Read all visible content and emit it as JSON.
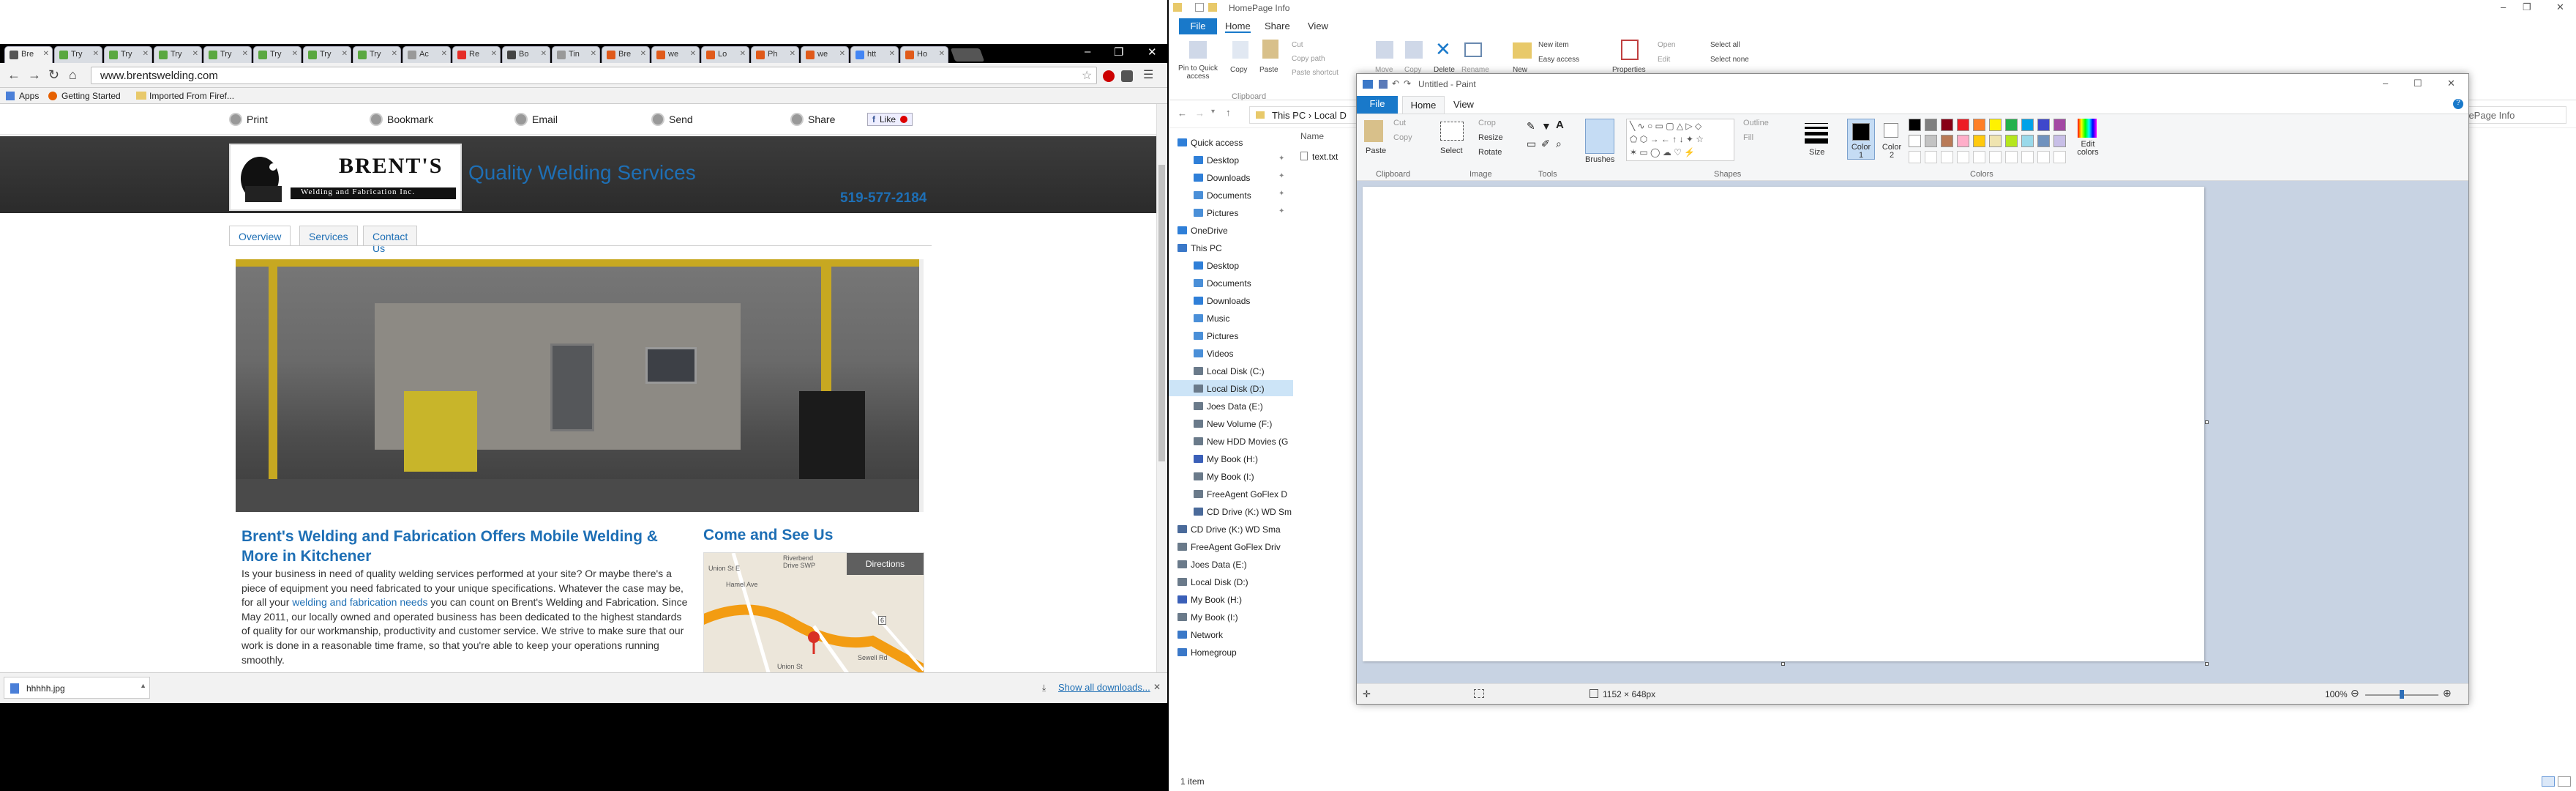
{
  "chrome": {
    "tabs": [
      {
        "label": "Bre",
        "favicon_color": "#555555",
        "active": true
      },
      {
        "label": "Try",
        "favicon_color": "#5aa840"
      },
      {
        "label": "Try",
        "favicon_color": "#5aa840"
      },
      {
        "label": "Try",
        "favicon_color": "#5aa840"
      },
      {
        "label": "Try",
        "favicon_color": "#5aa840"
      },
      {
        "label": "Try",
        "favicon_color": "#5aa840"
      },
      {
        "label": "Try",
        "favicon_color": "#5aa840"
      },
      {
        "label": "Try",
        "favicon_color": "#5aa840"
      },
      {
        "label": "Ac",
        "favicon_color": "#999999"
      },
      {
        "label": "Re",
        "favicon_color": "#e52d27"
      },
      {
        "label": "Bo",
        "favicon_color": "#444444"
      },
      {
        "label": "Tin",
        "favicon_color": "#999999"
      },
      {
        "label": "Bre",
        "favicon_color": "#e05a1a"
      },
      {
        "label": "we",
        "favicon_color": "#e05a1a"
      },
      {
        "label": "Lo",
        "favicon_color": "#e05a1a"
      },
      {
        "label": "Ph",
        "favicon_color": "#e05a1a"
      },
      {
        "label": "we",
        "favicon_color": "#e05a1a"
      },
      {
        "label": "htt",
        "favicon_color": "#4285f4"
      },
      {
        "label": "Ho",
        "favicon_color": "#e05a1a"
      }
    ],
    "url": "www.brentswelding.com",
    "bookmarks": {
      "apps": "Apps",
      "getting_started": "Getting Started",
      "imported": "Imported From Firef..."
    },
    "share_bar": {
      "print": "Print",
      "bookmark": "Bookmark",
      "email": "Email",
      "send": "Send",
      "share": "Share",
      "like": "Like"
    },
    "site": {
      "logo_name": "BRENT'S",
      "logo_sub": "Welding and Fabrication Inc.",
      "tagline": "Quality Welding Services",
      "phone": "519-577-2184",
      "tabs": [
        "Overview",
        "Services",
        "Contact Us"
      ],
      "headline": "Brent's Welding and Fabrication Offers Mobile Welding & More in Kitchener",
      "body_1": "Is your business in need of quality welding services performed at your site? Or maybe there's a piece of equipment you need fabricated to your unique specifications. Whatever the case may be, for all your ",
      "body_link": "welding and fabrication needs",
      "body_2": " you can count on Brent's Welding and Fabrication. Since May 2011, our locally owned and operated business has been dedicated to the highest standards of quality for our workmanship, productivity and customer service. We strive to make sure that our work is done in a reasonable time frame, so that you're able to keep your operations running smoothly.",
      "come_see": "Come and See Us",
      "directions": "Directions",
      "map_labels": [
        "Union St E",
        "Hamel Ave",
        "Riverbend Drive SWP",
        "Union St",
        "Sewell Rd",
        "6"
      ]
    },
    "download": {
      "file": "hhhhh.jpg",
      "show_all": "Show all downloads..."
    }
  },
  "explorer": {
    "title": "HomePage Info",
    "ribbon_tabs": [
      "File",
      "Home",
      "Share",
      "View"
    ],
    "ribbon": {
      "pin": "Pin to Quick access",
      "copy": "Copy",
      "paste": "Paste",
      "cut": "Cut",
      "copy_path": "Copy path",
      "paste_shortcut": "Paste shortcut",
      "clipboard": "Clipboard",
      "move_to": "Move",
      "copy_to": "Copy",
      "delete": "Delete",
      "rename": "Rename",
      "new_folder": "New",
      "new_item": "New item",
      "easy_access": "Easy access",
      "properties": "Properties",
      "open": "Open",
      "edit": "Edit",
      "select_all": "Select all",
      "select_none": "Select none"
    },
    "path": [
      "This PC",
      "Local D"
    ],
    "search": "HomePage Info",
    "column_name": "Name",
    "file": "text.txt",
    "tree": [
      {
        "label": "Quick access",
        "color": "#2f7fd8",
        "indent": 0
      },
      {
        "label": "Desktop",
        "color": "#2f7fd8",
        "indent": 1,
        "pin": true
      },
      {
        "label": "Downloads",
        "color": "#2f7fd8",
        "indent": 1,
        "pin": true
      },
      {
        "label": "Documents",
        "color": "#4a8fd8",
        "indent": 1,
        "pin": true
      },
      {
        "label": "Pictures",
        "color": "#4a8fd8",
        "indent": 1,
        "pin": true
      },
      {
        "label": "OneDrive",
        "color": "#2f7fd8",
        "indent": 0
      },
      {
        "label": "This PC",
        "color": "#3a78c8",
        "indent": 0
      },
      {
        "label": "Desktop",
        "color": "#2f7fd8",
        "indent": 1
      },
      {
        "label": "Documents",
        "color": "#4a8fd8",
        "indent": 1
      },
      {
        "label": "Downloads",
        "color": "#2f7fd8",
        "indent": 1
      },
      {
        "label": "Music",
        "color": "#4a8fd8",
        "indent": 1
      },
      {
        "label": "Pictures",
        "color": "#4a8fd8",
        "indent": 1
      },
      {
        "label": "Videos",
        "color": "#4a8fd8",
        "indent": 1
      },
      {
        "label": "Local Disk (C:)",
        "color": "#6a7a8a",
        "indent": 1
      },
      {
        "label": "Local Disk (D:)",
        "color": "#6a7a8a",
        "indent": 1,
        "selected": true
      },
      {
        "label": "Joes Data (E:)",
        "color": "#6a7a8a",
        "indent": 1
      },
      {
        "label": "New Volume (F:)",
        "color": "#6a7a8a",
        "indent": 1
      },
      {
        "label": "New HDD Movies (G",
        "color": "#6a7a8a",
        "indent": 1
      },
      {
        "label": "My Book (H:)",
        "color": "#3a5fb8",
        "indent": 1
      },
      {
        "label": "My Book (I:)",
        "color": "#6a7a8a",
        "indent": 1
      },
      {
        "label": "FreeAgent GoFlex D",
        "color": "#6a7a8a",
        "indent": 1
      },
      {
        "label": "CD Drive (K:) WD Sm",
        "color": "#4a6a9a",
        "indent": 1
      },
      {
        "label": "CD Drive (K:) WD Sma",
        "color": "#4a6a9a",
        "indent": 0
      },
      {
        "label": "FreeAgent GoFlex Driv",
        "color": "#6a7a8a",
        "indent": 0
      },
      {
        "label": "Joes Data (E:)",
        "color": "#6a7a8a",
        "indent": 0
      },
      {
        "label": "Local Disk (D:)",
        "color": "#6a7a8a",
        "indent": 0
      },
      {
        "label": "My Book (H:)",
        "color": "#3a5fb8",
        "indent": 0
      },
      {
        "label": "My Book (I:)",
        "color": "#6a7a8a",
        "indent": 0
      },
      {
        "label": "Network",
        "color": "#3a78c8",
        "indent": 0
      },
      {
        "label": "Homegroup",
        "color": "#3a78c8",
        "indent": 0
      }
    ],
    "status": "1 item"
  },
  "paint": {
    "title": "Untitled - Paint",
    "tabs": [
      "File",
      "Home",
      "View"
    ],
    "groups": {
      "clipboard": "Clipboard",
      "image": "Image",
      "tools": "Tools",
      "shapes": "Shapes",
      "colors": "Colors"
    },
    "labels": {
      "paste": "Paste",
      "cut": "Cut",
      "copy": "Copy",
      "select": "Select",
      "crop": "Crop",
      "resize": "Resize",
      "rotate": "Rotate",
      "brushes": "Brushes",
      "outline": "Outline",
      "fill": "Fill",
      "size": "Size",
      "color1": "Color 1",
      "color2": "Color 2",
      "edit_colors": "Edit colors"
    },
    "palette": [
      "#000000",
      "#7f7f7f",
      "#880015",
      "#ed1c24",
      "#ff7f27",
      "#fff200",
      "#22b14c",
      "#00a2e8",
      "#3f48cc",
      "#a349a4",
      "#ffffff",
      "#c3c3c3",
      "#b97a57",
      "#ffaec9",
      "#ffc90e",
      "#efe4b0",
      "#b5e61d",
      "#99d9ea",
      "#7092be",
      "#c8bfe7"
    ],
    "canvas_size": "1152 × 648px",
    "zoom": "100%"
  }
}
